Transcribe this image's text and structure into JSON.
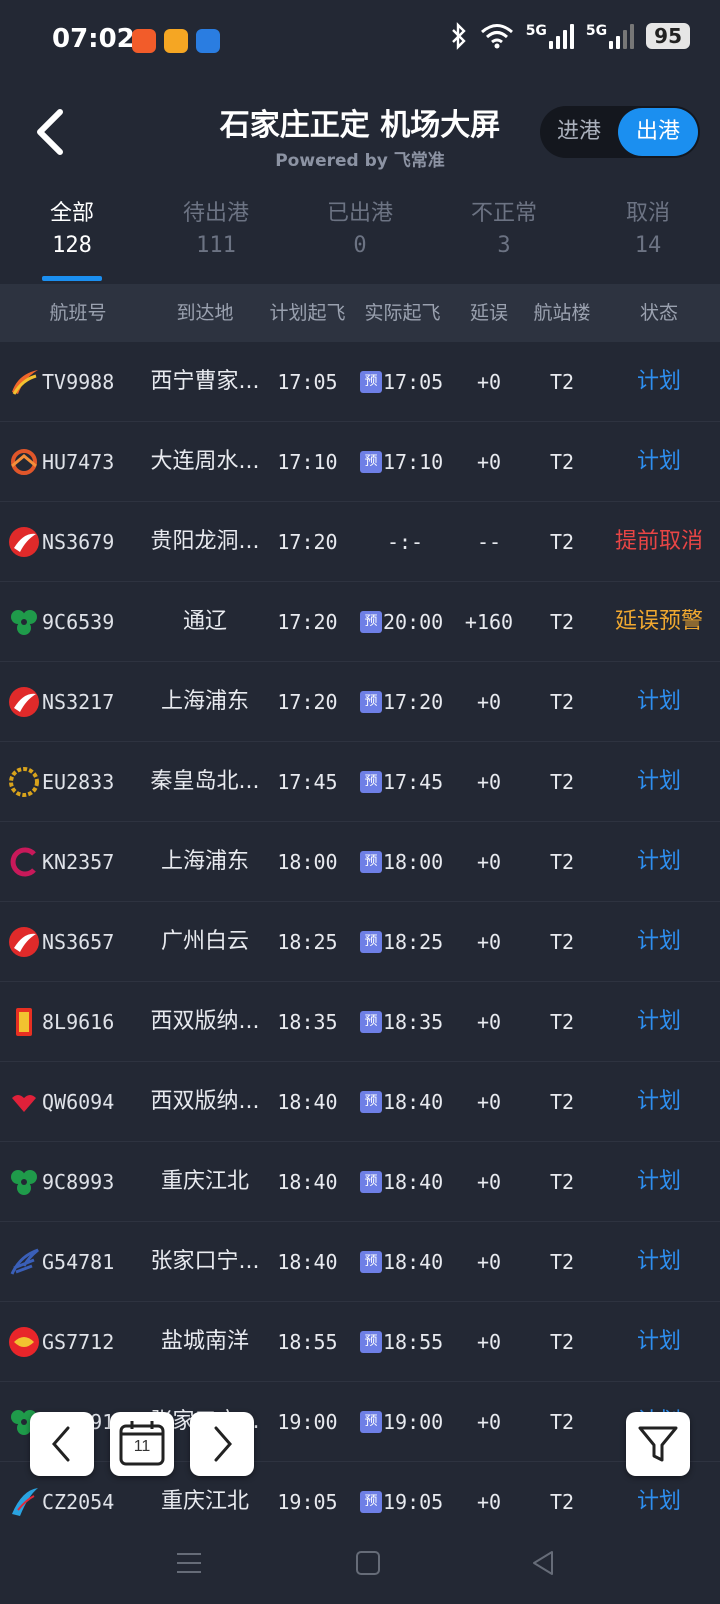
{
  "statusbar": {
    "time": "07:02",
    "battery": "95",
    "signal1": "5G",
    "signal2": "5G"
  },
  "header": {
    "title": "石家庄正定 机场大屏",
    "powered": "Powered by 飞常准",
    "toggle_in": "进港",
    "toggle_out": "出港"
  },
  "tabs": [
    {
      "label": "全部",
      "count": "128"
    },
    {
      "label": "待出港",
      "count": "111"
    },
    {
      "label": "已出港",
      "count": "0"
    },
    {
      "label": "不正常",
      "count": "3"
    },
    {
      "label": "取消",
      "count": "14"
    }
  ],
  "columns": [
    "航班号",
    "到达地",
    "计划起飞",
    "实际起飞",
    "延误",
    "航站楼",
    "状态"
  ],
  "pre_label": "预",
  "flights": [
    {
      "flight": "TV9988",
      "dest": "西宁曹家...",
      "sched": "17:05",
      "actual": "17:05",
      "pre": true,
      "delay": "+0",
      "term": "T2",
      "status": "计划",
      "status_color": "#2e8ff0",
      "logo": "tibet"
    },
    {
      "flight": "HU7473",
      "dest": "大连周水...",
      "sched": "17:10",
      "actual": "17:10",
      "pre": true,
      "delay": "+0",
      "term": "T2",
      "status": "计划",
      "status_color": "#2e8ff0",
      "logo": "hainan"
    },
    {
      "flight": "NS3679",
      "dest": "贵阳龙洞...",
      "sched": "17:20",
      "actual": "-:-",
      "pre": false,
      "delay": "--",
      "term": "T2",
      "status": "提前取消",
      "status_color": "#e84545",
      "logo": "hebei"
    },
    {
      "flight": "9C6539",
      "dest": "通辽",
      "sched": "17:20",
      "actual": "20:00",
      "pre": true,
      "delay": "+160",
      "term": "T2",
      "status": "延误预警",
      "status_color": "#f0a830",
      "logo": "spring"
    },
    {
      "flight": "NS3217",
      "dest": "上海浦东",
      "sched": "17:20",
      "actual": "17:20",
      "pre": true,
      "delay": "+0",
      "term": "T2",
      "status": "计划",
      "status_color": "#2e8ff0",
      "logo": "hebei"
    },
    {
      "flight": "EU2833",
      "dest": "秦皇岛北...",
      "sched": "17:45",
      "actual": "17:45",
      "pre": true,
      "delay": "+0",
      "term": "T2",
      "status": "计划",
      "status_color": "#2e8ff0",
      "logo": "chengdu"
    },
    {
      "flight": "KN2357",
      "dest": "上海浦东",
      "sched": "18:00",
      "actual": "18:00",
      "pre": true,
      "delay": "+0",
      "term": "T2",
      "status": "计划",
      "status_color": "#2e8ff0",
      "logo": "united"
    },
    {
      "flight": "NS3657",
      "dest": "广州白云",
      "sched": "18:25",
      "actual": "18:25",
      "pre": true,
      "delay": "+0",
      "term": "T2",
      "status": "计划",
      "status_color": "#2e8ff0",
      "logo": "hebei"
    },
    {
      "flight": "8L9616",
      "dest": "西双版纳...",
      "sched": "18:35",
      "actual": "18:35",
      "pre": true,
      "delay": "+0",
      "term": "T2",
      "status": "计划",
      "status_color": "#2e8ff0",
      "logo": "luckyair"
    },
    {
      "flight": "QW6094",
      "dest": "西双版纳...",
      "sched": "18:40",
      "actual": "18:40",
      "pre": true,
      "delay": "+0",
      "term": "T2",
      "status": "计划",
      "status_color": "#2e8ff0",
      "logo": "qingdao"
    },
    {
      "flight": "9C8993",
      "dest": "重庆江北",
      "sched": "18:40",
      "actual": "18:40",
      "pre": true,
      "delay": "+0",
      "term": "T2",
      "status": "计划",
      "status_color": "#2e8ff0",
      "logo": "spring"
    },
    {
      "flight": "G54781",
      "dest": "张家口宁...",
      "sched": "18:40",
      "actual": "18:40",
      "pre": true,
      "delay": "+0",
      "term": "T2",
      "status": "计划",
      "status_color": "#2e8ff0",
      "logo": "huaxia"
    },
    {
      "flight": "GS7712",
      "dest": "盐城南洋",
      "sched": "18:55",
      "actual": "18:55",
      "pre": true,
      "delay": "+0",
      "term": "T2",
      "status": "计划",
      "status_color": "#2e8ff0",
      "logo": "tianjin"
    },
    {
      "flight": "9C8991",
      "dest": "张家口宁...",
      "sched": "19:00",
      "actual": "19:00",
      "pre": true,
      "delay": "+0",
      "term": "T2",
      "status": "计划",
      "status_color": "#2e8ff0",
      "logo": "spring"
    },
    {
      "flight": "CZ2054",
      "dest": "重庆江北",
      "sched": "19:05",
      "actual": "19:05",
      "pre": true,
      "delay": "+0",
      "term": "T2",
      "status": "计划",
      "status_color": "#2e8ff0",
      "logo": "southern"
    }
  ],
  "calendar_day": "11"
}
